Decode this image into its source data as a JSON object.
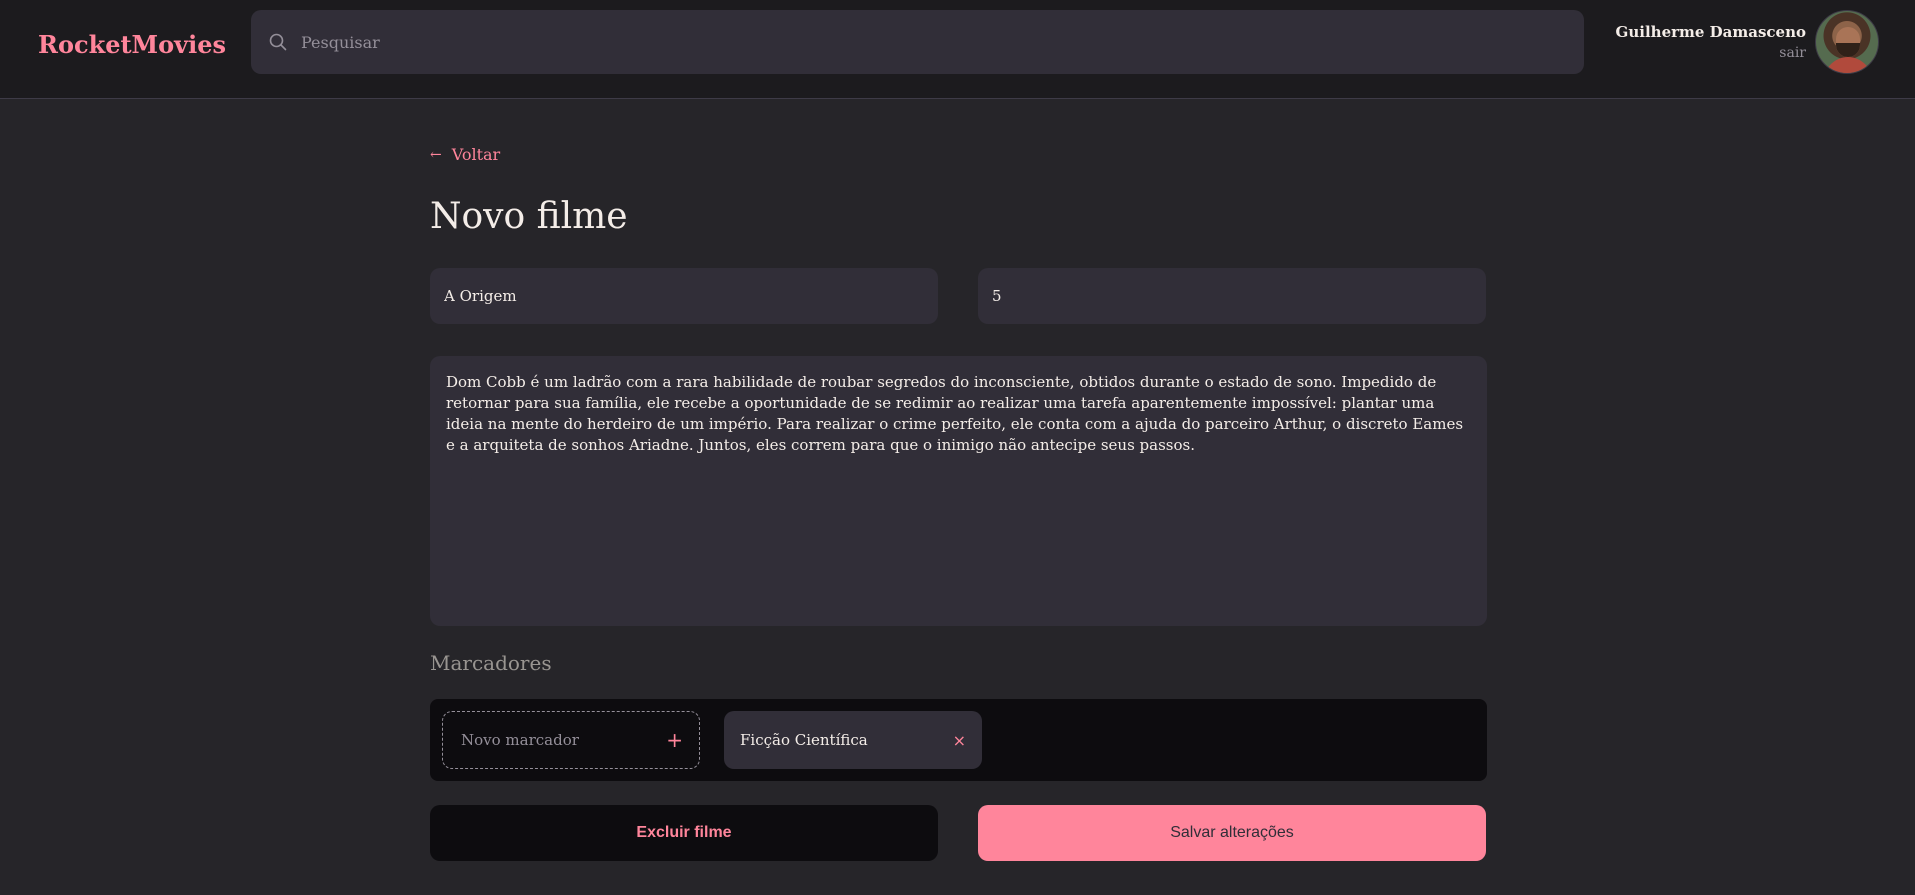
{
  "header": {
    "brand": "RocketMovies",
    "search_placeholder": "Pesquisar",
    "user_name": "Guilherme Damasceno",
    "logout_label": "sair"
  },
  "page": {
    "back_label": "Voltar",
    "title": "Novo filme"
  },
  "form": {
    "title_value": "A Origem",
    "rating_value": "5",
    "description": "Dom Cobb é um ladrão com a rara habilidade de roubar segredos do inconsciente, obtidos durante o estado de sono. Impedido de retornar para sua família, ele recebe a oportunidade de se redimir ao realizar uma tarefa aparentemente impossível: plantar uma ideia na mente do herdeiro de um império. Para realizar o crime perfeito, ele conta com a ajuda do parceiro Arthur, o discreto Eames e a arquiteta de sonhos Ariadne. Juntos, eles correm para que o inimigo não antecipe seus passos.",
    "tags_label": "Marcadores",
    "new_tag_placeholder": "Novo marcador",
    "add_tag_icon": "+",
    "tags": [
      {
        "label": "Ficção Científica",
        "remove_icon": "×"
      }
    ]
  },
  "actions": {
    "delete_label": "Excluir filme",
    "save_label": "Salvar alterações"
  },
  "colors": {
    "accent": "#ff859b",
    "background": "#262529",
    "surface": "#312e38",
    "dark": "#0d0c0f"
  },
  "icons": {
    "search": "search-icon",
    "back": "arrow-left-icon",
    "add": "plus-icon",
    "remove": "close-icon"
  }
}
